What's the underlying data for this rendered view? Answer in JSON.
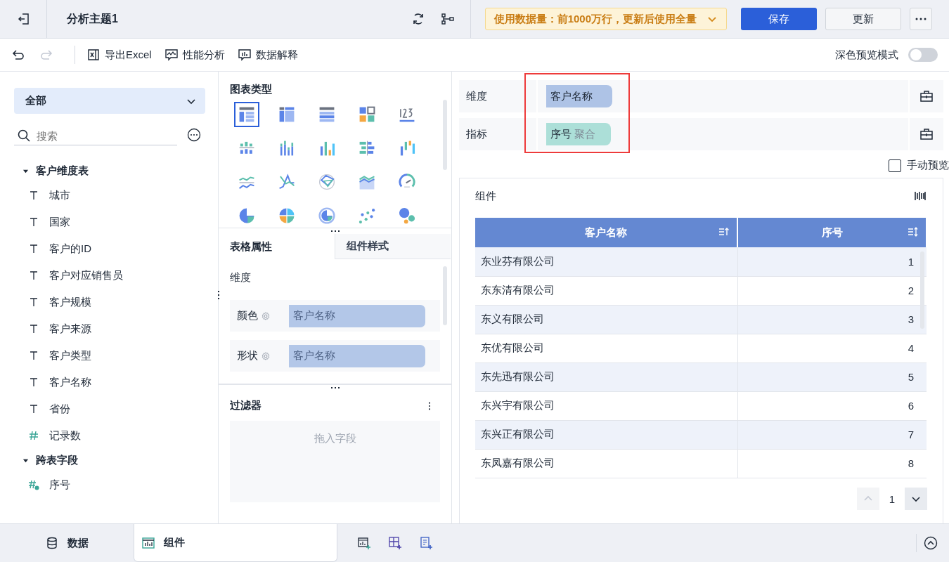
{
  "header": {
    "title": "分析主题1",
    "data_notice": "使用数据量：前1000万行，更新后使用全量",
    "buttons": [
      {
        "label": "保存",
        "kind": "primary"
      },
      {
        "label": "更新",
        "kind": "default"
      }
    ]
  },
  "toolbar": {
    "actions": [
      {
        "label": "导出Excel"
      },
      {
        "label": "性能分析"
      },
      {
        "label": "数据解释"
      }
    ],
    "undo_disabled": false,
    "redo_disabled": true,
    "dark_preview": {
      "label": "深色预览模式",
      "on": false
    }
  },
  "data_panel": {
    "dropdown": "全部",
    "search": {
      "placeholder": "搜索"
    },
    "tree": [
      {
        "label": "客户维度表",
        "expanded": true,
        "children": [
          {
            "label": "城市",
            "kind": "text"
          },
          {
            "label": "国家",
            "kind": "text"
          },
          {
            "label": "客户的ID",
            "kind": "text"
          },
          {
            "label": "客户对应销售员",
            "kind": "text"
          },
          {
            "label": "客户规模",
            "kind": "text"
          },
          {
            "label": "客户来源",
            "kind": "text"
          },
          {
            "label": "客户类型",
            "kind": "text"
          },
          {
            "label": "客户名称",
            "kind": "text"
          },
          {
            "label": "省份",
            "kind": "text"
          },
          {
            "label": "记录数",
            "kind": "number"
          }
        ]
      },
      {
        "label": "跨表字段",
        "expanded": true,
        "children": [
          {
            "label": "序号",
            "kind": "calc"
          }
        ]
      }
    ]
  },
  "chart_types": {
    "title": "图表类型",
    "items": [
      {
        "selected": true
      },
      {
        "selected": false
      },
      {
        "selected": false
      },
      {
        "selected": false
      },
      {
        "selected": false
      },
      {
        "selected": false
      },
      {
        "selected": false
      },
      {
        "selected": false
      },
      {
        "selected": false
      },
      {
        "selected": false
      },
      {
        "selected": false
      },
      {
        "selected": false
      },
      {
        "selected": false
      },
      {
        "selected": false
      },
      {
        "selected": false
      },
      {
        "selected": false
      },
      {
        "selected": false
      },
      {
        "selected": false
      },
      {
        "selected": false
      },
      {
        "selected": false
      }
    ]
  },
  "property_tabs": [
    {
      "label": "表格属性",
      "selected": true
    },
    {
      "label": "组件样式",
      "selected": false
    }
  ],
  "properties": {
    "section": "维度",
    "rows": [
      {
        "label": "颜色",
        "placeholder": "客户名称"
      },
      {
        "label": "形状",
        "placeholder": "客户名称"
      }
    ]
  },
  "filter": {
    "title": "过滤器",
    "drop_hint": "拖入字段"
  },
  "shelves": [
    {
      "label": "维度",
      "pills": [
        {
          "field": "客户名称",
          "kind": "dimension"
        }
      ]
    },
    {
      "label": "指标",
      "pills": [
        {
          "field": "序号",
          "aggregate": "聚合",
          "kind": "measure"
        }
      ]
    }
  ],
  "manual_preview": {
    "label": "手动预览",
    "checked": false
  },
  "component": {
    "title": "组件",
    "table": {
      "columns": [
        {
          "name": "客户名称",
          "sorted": true
        },
        {
          "name": "序号",
          "sorted": false
        }
      ],
      "rows": [
        [
          "东业芬有限公司",
          "1"
        ],
        [
          "东东清有限公司",
          "2"
        ],
        [
          "东义有限公司",
          "3"
        ],
        [
          "东优有限公司",
          "4"
        ],
        [
          "东先迅有限公司",
          "5"
        ],
        [
          "东兴宇有限公司",
          "6"
        ],
        [
          "东兴正有限公司",
          "7"
        ],
        [
          "东凤嘉有限公司",
          "8"
        ]
      ]
    },
    "pagination": {
      "page": "1",
      "prev_disabled": true,
      "next_disabled": false
    }
  },
  "bottom_tabs": [
    {
      "label": "数据",
      "kind": "data",
      "selected": false
    },
    {
      "label": "组件",
      "kind": "component",
      "selected": true
    }
  ]
}
